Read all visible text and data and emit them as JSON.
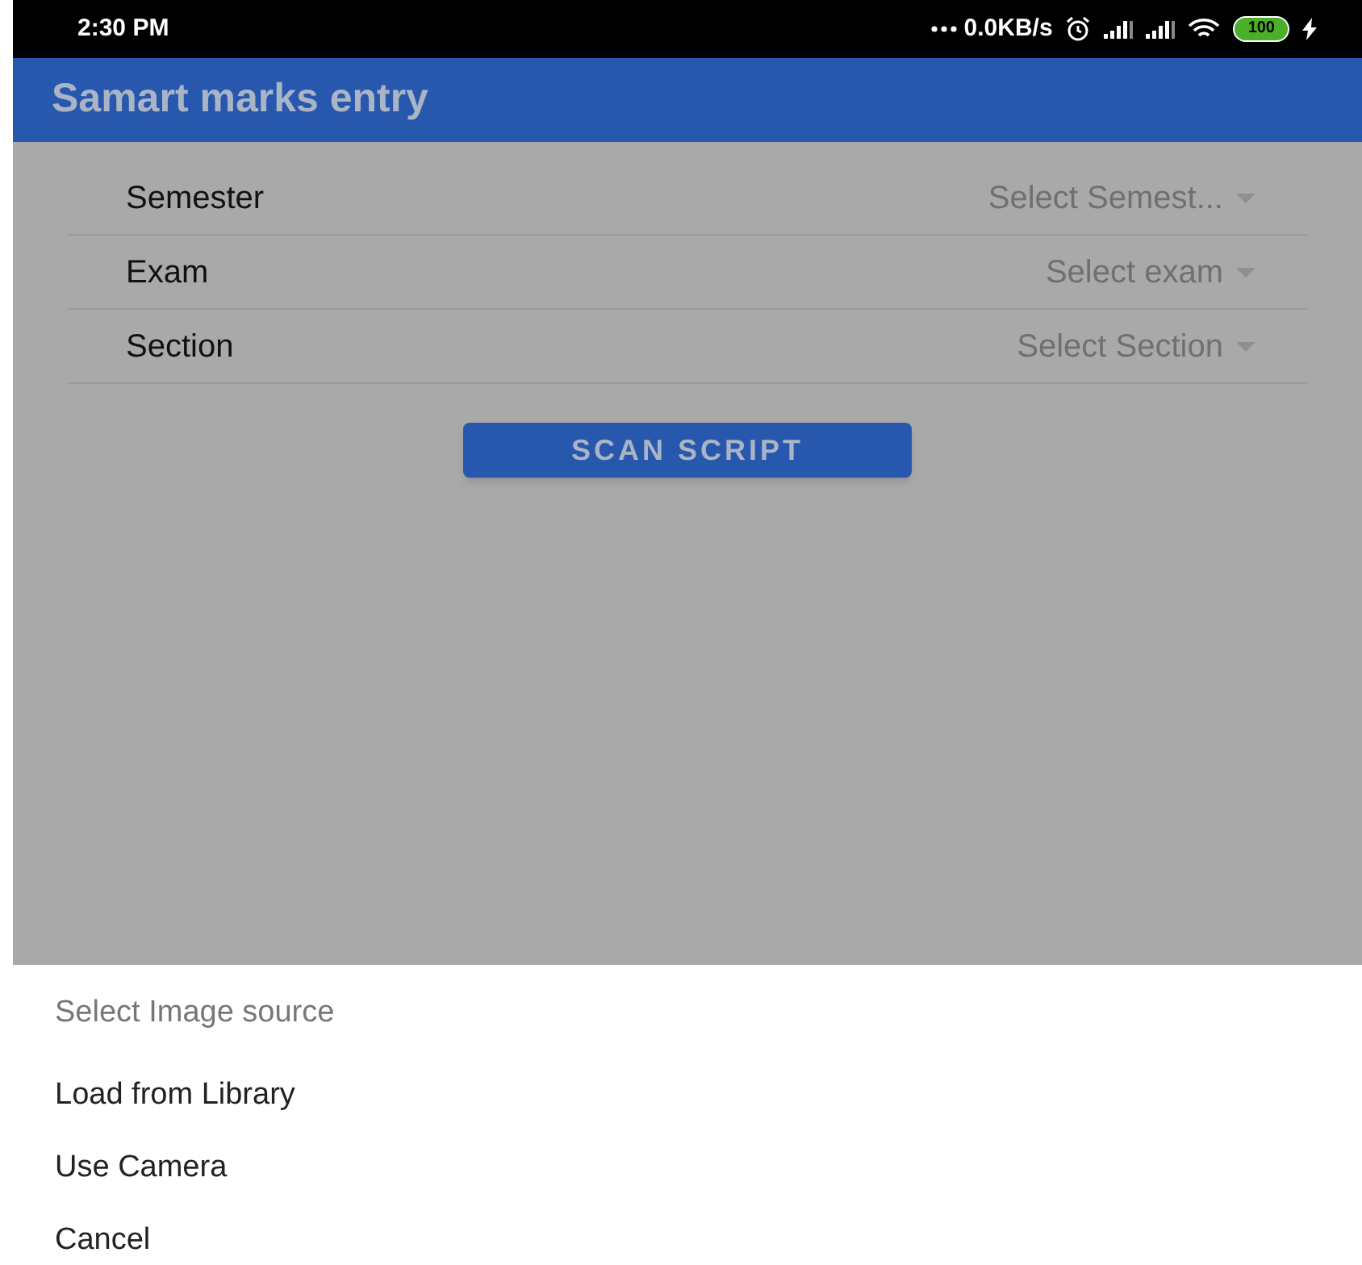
{
  "status_bar": {
    "time": "2:30 PM",
    "speed": "0.0KB/s",
    "battery": "100"
  },
  "app_bar": {
    "title": "Samart marks entry"
  },
  "form": {
    "rows": [
      {
        "label": "Semester",
        "placeholder": "Select Semest..."
      },
      {
        "label": "Exam",
        "placeholder": "Select exam"
      },
      {
        "label": "Section",
        "placeholder": "Select Section"
      }
    ],
    "button": "SCAN SCRIPT"
  },
  "sheet": {
    "title": "Select Image source",
    "options": [
      "Load from Library",
      "Use Camera",
      "Cancel"
    ]
  }
}
